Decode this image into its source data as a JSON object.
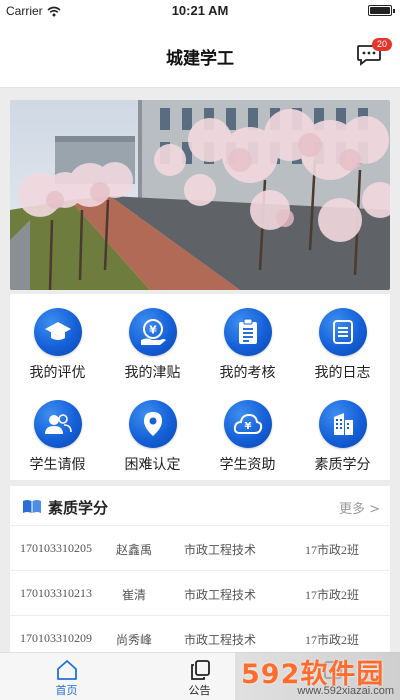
{
  "status": {
    "carrier": "Carrier",
    "time": "10:21 AM"
  },
  "header": {
    "title": "城建学工",
    "badge": "20"
  },
  "grid": [
    {
      "label": "我的评优",
      "icon": "graduation-cap-icon"
    },
    {
      "label": "我的津贴",
      "icon": "yen-hand-icon"
    },
    {
      "label": "我的考核",
      "icon": "clipboard-icon"
    },
    {
      "label": "我的日志",
      "icon": "notebook-icon"
    },
    {
      "label": "学生请假",
      "icon": "people-icon"
    },
    {
      "label": "困难认定",
      "icon": "location-pin-icon"
    },
    {
      "label": "学生资助",
      "icon": "yen-cloud-icon"
    },
    {
      "label": "素质学分",
      "icon": "building-icon"
    }
  ],
  "section": {
    "title": "素质学分",
    "more": "更多 >",
    "rows": [
      {
        "id": "170103310205",
        "name": "赵鑫禹",
        "major": "市政工程技术",
        "class": "17市政2班"
      },
      {
        "id": "170103310213",
        "name": "崔清",
        "major": "市政工程技术",
        "class": "17市政2班"
      },
      {
        "id": "170103310209",
        "name": "尚秀峰",
        "major": "市政工程技术",
        "class": "17市政2班"
      }
    ]
  },
  "tabs": [
    {
      "label": "首页",
      "icon": "home-icon",
      "active": true
    },
    {
      "label": "公告",
      "icon": "copy-icon",
      "active": false
    },
    {
      "label": "",
      "icon": "profile-icon",
      "active": false
    }
  ],
  "watermark": {
    "brand": "592软件园",
    "url": "www.592xiazai.com"
  },
  "colors": {
    "accent": "#1f72d8",
    "icon_blue": "#1560d8",
    "badge": "#e8352b"
  }
}
